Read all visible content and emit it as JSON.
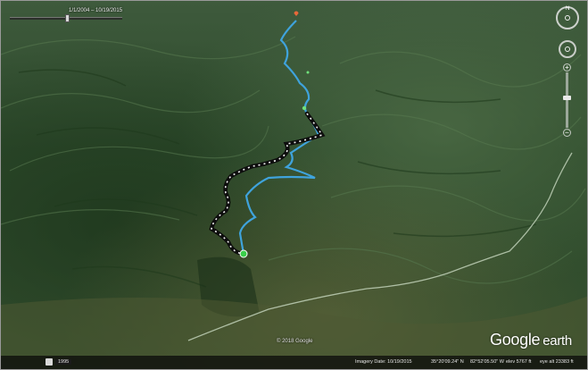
{
  "window": {
    "title": "Google Earth"
  },
  "time_slider": {
    "label": "1/1/2004 – 10/19/2015"
  },
  "map": {
    "route_color": "#3fa3dc",
    "track_color": "#0d0d0d",
    "start_marker_color": "#3ad04a",
    "end_marker_color": "#e8683a",
    "road_color": "#c8d8c0"
  },
  "copyright": "© 2018 Google",
  "logo": {
    "google": "Google",
    "earth": "earth"
  },
  "status_bar": {
    "tour_year": "1995",
    "imagery_date": "Imagery Date: 10/19/2015",
    "lat": "35°20'09.24\" N",
    "lon": "82°52'05.50\" W",
    "elev": "elev  5767 ft",
    "eye_alt": "eye alt  23383 ft"
  }
}
